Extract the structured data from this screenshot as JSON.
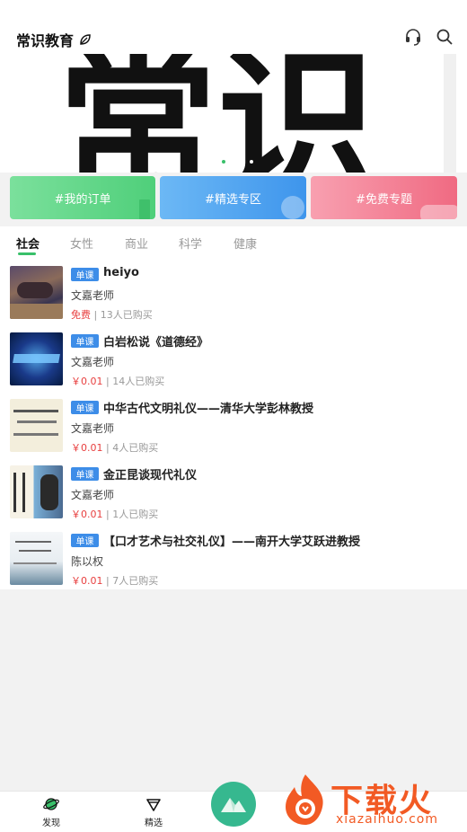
{
  "header": {
    "title": "常识教育",
    "title_icon": "leaf-icon",
    "support_icon": "headset-icon",
    "search_icon": "search-icon"
  },
  "banner": {
    "text": "常识",
    "active_dot_color": "#39c06a"
  },
  "quick_links": [
    {
      "label": "#我的订单",
      "color": "#66d98a"
    },
    {
      "label": "#精选专区",
      "color": "#52a8f2"
    },
    {
      "label": "#免费专题",
      "color": "#f57f95"
    }
  ],
  "tabs": [
    "社会",
    "女性",
    "商业",
    "科学",
    "健康"
  ],
  "active_tab": "社会",
  "courses": [
    {
      "tag": "单课",
      "title": "heiyo",
      "teacher": "文嘉老师",
      "price": "免费",
      "buyers": "| 13人已购买"
    },
    {
      "tag": "单课",
      "title": "白岩松说《道德经》",
      "teacher": "文嘉老师",
      "price": "￥0.01",
      "buyers": "| 14人已购买"
    },
    {
      "tag": "单课",
      "title": "中华古代文明礼仪——清华大学彭林教授",
      "teacher": "文嘉老师",
      "price": "￥0.01",
      "buyers": "| 4人已购买"
    },
    {
      "tag": "单课",
      "title": "金正昆谈现代礼仪",
      "teacher": "文嘉老师",
      "price": "￥0.01",
      "buyers": "| 1人已购买"
    },
    {
      "tag": "单课",
      "title": "【口才艺术与社交礼仪】——南开大学艾跃进教授",
      "teacher": "陈以权",
      "price": "￥0.01",
      "buyers": "| 7人已购买"
    }
  ],
  "bottom_nav": [
    {
      "label": "发现",
      "icon": "planet-icon"
    },
    {
      "label": "精选",
      "icon": "diamond-icon"
    }
  ],
  "watermark": {
    "text": "下载火",
    "url": "xiazaihuo.com"
  }
}
